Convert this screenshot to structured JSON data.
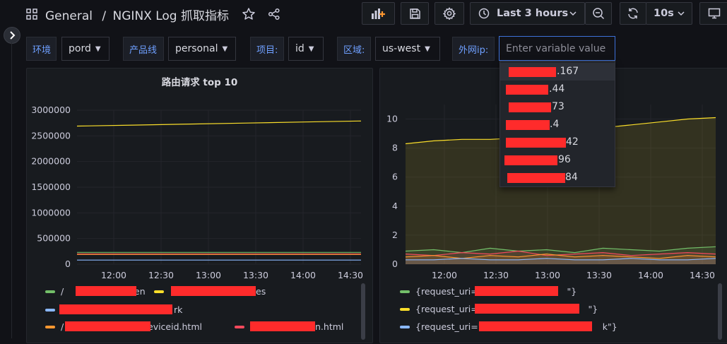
{
  "header": {
    "grid_icon": "apps-icon",
    "breadcrumb_root": "General",
    "breadcrumb_sep": "/",
    "dashboard_title": "NGINX Log 抓取指标",
    "time_range": "Last 3 hours",
    "refresh_interval": "10s"
  },
  "variables": [
    {
      "label": "环境",
      "value": "pord"
    },
    {
      "label": "产品线",
      "value": "personal"
    },
    {
      "label": "项目:",
      "value": "id"
    },
    {
      "label": "区域:",
      "value": "us-west"
    }
  ],
  "ip_variable": {
    "label": "外网ip:",
    "placeholder": "Enter variable value",
    "options": [
      ".167",
      ".44",
      "73",
      ".4",
      "42",
      "96",
      "84"
    ]
  },
  "colors": {
    "green": "#73bf69",
    "yellow": "#fade2a",
    "blue": "#8ab8ff",
    "orange": "#ff9830",
    "red": "#f2495c",
    "accent": "#3d71d9",
    "redaction": "#ff2b2b"
  },
  "panel_left": {
    "title": "路由请求 top 10",
    "legend": [
      {
        "color": "green",
        "suffix": "en"
      },
      {
        "color": "yellow",
        "suffix": "es"
      },
      {
        "color": "blue",
        "suffix": "rk"
      },
      {
        "color": "orange",
        "suffix": "eviceid.html"
      },
      {
        "color": "red",
        "suffix": "n.html"
      }
    ]
  },
  "panel_right": {
    "legend": [
      {
        "color": "green",
        "text_prefix": "{request_uri=\"",
        "text_suffix": "\"}"
      },
      {
        "color": "yellow",
        "text_prefix": "{request_uri=\"",
        "text_suffix": "\"}"
      },
      {
        "color": "blue",
        "text_prefix": "{request_uri=\"/",
        "text_suffix": "k\"}"
      }
    ]
  },
  "chart_data": [
    {
      "type": "line",
      "title": "路由请求 top 10",
      "x": [
        "12:00",
        "12:30",
        "13:00",
        "13:30",
        "14:00",
        "14:30"
      ],
      "ylim": [
        0,
        3000000
      ],
      "yticks": [
        "3000000",
        "2500000",
        "2000000",
        "1500000",
        "1000000",
        "500000",
        "0"
      ],
      "series": [
        {
          "color": "yellow",
          "values": [
            2690000,
            2710000,
            2730000,
            2750000,
            2770000,
            2790000
          ]
        },
        {
          "color": "green",
          "values": [
            230000,
            230000,
            230000,
            230000,
            230000,
            230000
          ]
        },
        {
          "color": "red",
          "values": [
            200000,
            200000,
            200000,
            200000,
            200000,
            200000
          ]
        },
        {
          "color": "orange",
          "values": [
            190000,
            190000,
            190000,
            190000,
            190000,
            190000
          ]
        },
        {
          "color": "blue",
          "values": [
            80000,
            80000,
            80000,
            80000,
            80000,
            80000
          ]
        }
      ]
    },
    {
      "type": "area",
      "x": [
        "12:00",
        "12:30",
        "13:00",
        "13:30",
        "14:00",
        "14:30"
      ],
      "ylim": [
        0,
        11
      ],
      "yticks": [
        "10",
        "8",
        "6",
        "4",
        "2",
        "0"
      ],
      "series": [
        {
          "color": "yellow",
          "values": [
            8.3,
            8.5,
            8.6,
            8.6,
            8.7,
            9.0,
            9.2,
            9.4,
            9.6,
            9.8,
            10.0,
            10.1
          ]
        },
        {
          "color": "green",
          "values": [
            0.9,
            1.0,
            0.8,
            1.1,
            0.9,
            1.0,
            0.8,
            1.1,
            1.0,
            0.9,
            1.1,
            1.2
          ]
        },
        {
          "color": "red",
          "values": [
            0.7,
            0.6,
            0.8,
            0.7,
            0.9,
            0.6,
            0.7,
            0.8,
            0.6,
            0.7,
            0.8,
            0.7
          ]
        },
        {
          "color": "orange",
          "values": [
            0.5,
            0.6,
            0.4,
            0.6,
            0.5,
            0.7,
            0.5,
            0.6,
            0.5,
            0.4,
            0.6,
            0.5
          ]
        },
        {
          "color": "blue",
          "values": [
            0.3,
            0.3,
            0.4,
            0.3,
            0.3,
            0.4,
            0.3,
            0.3,
            0.4,
            0.3,
            0.3,
            0.4
          ]
        }
      ]
    }
  ]
}
